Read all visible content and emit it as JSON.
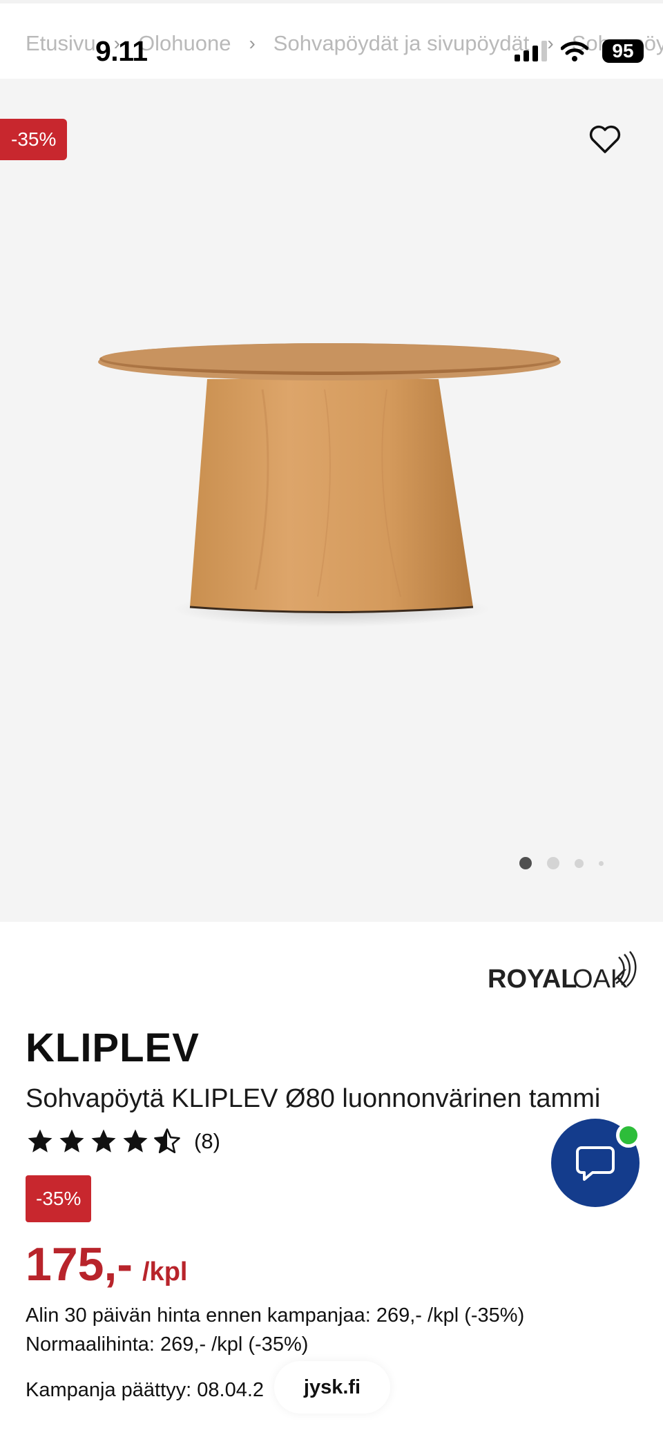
{
  "status_bar": {
    "time": "9.11",
    "battery": "95"
  },
  "breadcrumb": [
    "Etusivu",
    "Olohuone",
    "Sohvapöydät ja sivupöydät",
    "Sohvapöy"
  ],
  "gallery": {
    "discount": "-35%",
    "slides_total": 4,
    "active_slide": 1
  },
  "brand": {
    "name": "ROYAL OAK"
  },
  "product": {
    "name": "KLIPLEV",
    "description": "Sohvapöytä KLIPLEV Ø80 luonnonvärinen tammi",
    "rating": 4.5,
    "rating_count": "(8)",
    "discount_badge": "-35%",
    "price": "175,-",
    "price_unit": "/kpl",
    "lowest_price_note": "Alin 30 päivän hinta ennen kampanjaa: 269,- /kpl (-35%)",
    "normal_price_note": "Normaalihinta: 269,- /kpl (-35%)",
    "campaign_end": "Kampanja päättyy: 08.04.2"
  },
  "browser": {
    "url": "jysk.fi"
  },
  "colors": {
    "sale_red": "#c8272e",
    "chat_blue": "#143c8c",
    "online_green": "#2dbd3a"
  }
}
